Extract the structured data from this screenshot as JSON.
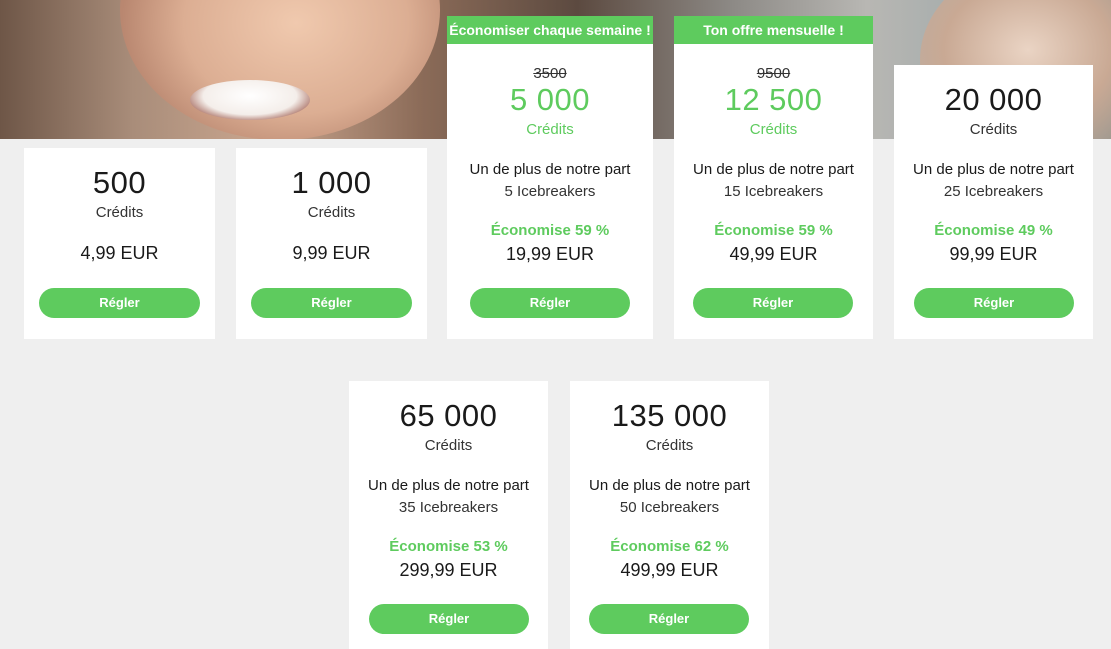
{
  "colors": {
    "accent": "#5ecb5e",
    "background": "#efefef",
    "card": "#ffffff"
  },
  "hero": {
    "image": "smiling-faces-banner"
  },
  "packages": [
    {
      "amount": "500",
      "unit": "Crédits",
      "price": "4,99 EUR",
      "button": "Régler"
    },
    {
      "amount": "1 000",
      "unit": "Crédits",
      "price": "9,99 EUR",
      "button": "Régler"
    },
    {
      "ribbon": "Économiser chaque semaine !",
      "old_amount": "3500",
      "amount": "5 000",
      "unit": "Crédits",
      "bonus": "Un de plus de notre part",
      "icebreakers": "5 Icebreakers",
      "savings": "Économise 59 %",
      "price": "19,99 EUR",
      "button": "Régler"
    },
    {
      "ribbon": "Ton offre mensuelle !",
      "old_amount": "9500",
      "amount": "12 500",
      "unit": "Crédits",
      "bonus": "Un de plus de notre part",
      "icebreakers": "15 Icebreakers",
      "savings": "Économise 59 %",
      "price": "49,99 EUR",
      "button": "Régler"
    },
    {
      "amount": "20 000",
      "unit": "Crédits",
      "bonus": "Un de plus de notre part",
      "icebreakers": "25 Icebreakers",
      "savings": "Économise 49 %",
      "price": "99,99 EUR",
      "button": "Régler"
    },
    {
      "amount": "65 000",
      "unit": "Crédits",
      "bonus": "Un de plus de notre part",
      "icebreakers": "35 Icebreakers",
      "savings": "Économise 53 %",
      "price": "299,99 EUR",
      "button": "Régler"
    },
    {
      "amount": "135 000",
      "unit": "Crédits",
      "bonus": "Un de plus de notre part",
      "icebreakers": "50 Icebreakers",
      "savings": "Économise 62 %",
      "price": "499,99 EUR",
      "button": "Régler"
    }
  ]
}
